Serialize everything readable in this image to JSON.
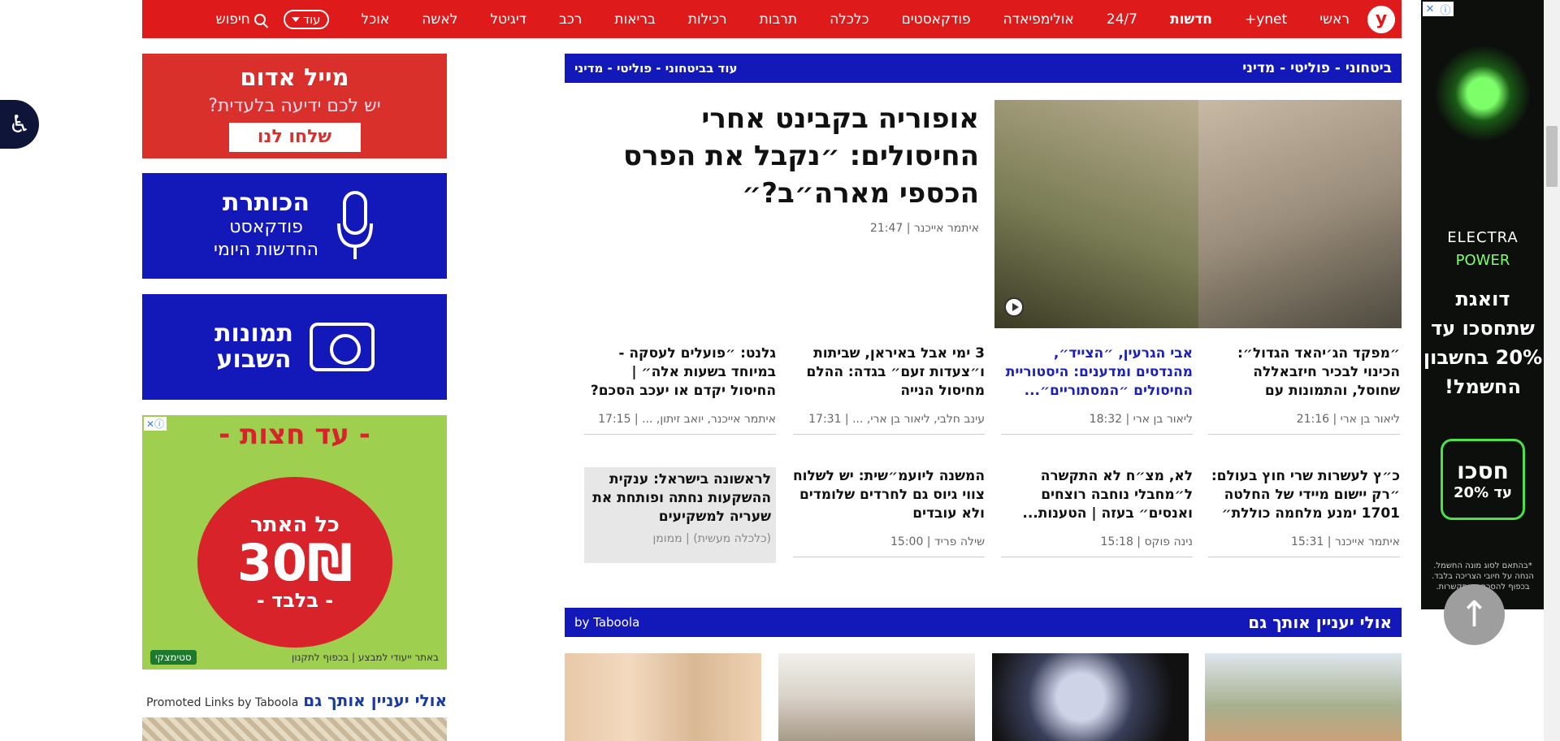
{
  "nav": {
    "logo": "y",
    "items": [
      "ראשי",
      "ynet+",
      "חדשות",
      "24/7",
      "אולימפיאדה",
      "פודקאסטים",
      "כלכלה",
      "תרבות",
      "רכילות",
      "בריאות",
      "רכב",
      "דיגיטל",
      "לאשה",
      "אוכל"
    ],
    "more_label": "עוד",
    "search_label": "חיפוש"
  },
  "sidebar": {
    "red_mail": {
      "title": "מייל אדום",
      "subtitle": "יש לכם ידיעה בלעדית?",
      "button": "שלחו לנו"
    },
    "podcast": {
      "title": "הכותרת",
      "line1": "פודקאסט",
      "line2": "החדשות היומי"
    },
    "photos": {
      "title": "תמונות",
      "line2": "השבוע"
    },
    "ad": {
      "header": "- עד חצות -",
      "line1": "כל האתר",
      "price": "30₪",
      "line3": "- בלבד -",
      "footer": "באתר ייעודי למבצע | בכפוף לתקנון",
      "brand": "סטימצקי"
    },
    "promoted_title": "אולי יעניין אותך גם",
    "promoted_links": "Promoted Links by Taboola"
  },
  "section": {
    "title": "ביטחוני - פוליטי - מדיני",
    "more": "עוד בביטחוני - פוליטי - מדיני"
  },
  "hero": {
    "title": "אופוריה בקבינט אחרי החיסולים: ״נקבל את הפרס הכספי מארה״ב?״",
    "author": "איתמר אייכנר",
    "time": "21:47"
  },
  "articles": [
    {
      "title": "״מפקד הג׳יהאד הגדול״: הכינוי לבכיר חיזבאללה שחוסל, והתמונות עם נסראללה...",
      "meta": "ליאור בן ארי | 21:16"
    },
    {
      "title": "אבי הגרעין, ״הצייד״, מהנדסים ומדענים: היסטוריית החיסולים ״המסתוריים״...",
      "meta": "ליאור בן ארי | 18:32"
    },
    {
      "title": "3 ימי אבל באיראן, שביתות ו״צעדות זעם״ בגדה: ההלם מחיסול הנייה",
      "meta": "עינב חלבי, ליאור בן ארי, ... | 17:31"
    },
    {
      "title": "גלנט: ״פועלים לעסקה - במיוחד בשעות אלה״ | החיסול יקדם או יעכב הסכם?",
      "meta": "איתמר אייכנר, יואב זיתון, ... | 17:15"
    },
    {
      "title": "כ״ץ לעשרות שרי חוץ בעולם: ״רק יישום מיידי של החלטה 1701 ימנע מלחמה כוללת״",
      "meta": "איתמר אייכנר | 15:31"
    },
    {
      "title": "לא, מצ״ח לא התקשרה ל״מחבלי נוחבה רוצחים ואנסים״ בעזה | הטענות...",
      "meta": "נינה פוקס | 15:18"
    },
    {
      "title": "המשנה ליועמ״שית: יש לשלוח צווי גיוס גם לחרדים שלומדים ולא עובדים",
      "meta": "שילה פריד | 15:00"
    },
    {
      "title": "לראשונה בישראל: ענקית ההשקעות נחתה ופותחת את שעריה למשקיעים",
      "meta": "(כלכלה מעשית) | ממומן"
    }
  ],
  "taboola": {
    "title": "אולי יעניין אותך גם",
    "by": "by Taboola"
  },
  "right_ad": {
    "brand": "ELECTRA",
    "brand2": "POWER",
    "headline": "דואגת שתחסכו עד 20% בחשבון החשמל!",
    "button_line1": "חסכו",
    "button_line2": "עד 20%",
    "fine_print": "*בהתאם לסוג מונה החשמל. הנחה על חיובי הצריכה בלבד. בכפוף להסכם ההתקשרות."
  },
  "colors": {
    "brand_red": "#de1a1a",
    "section_blue": "#1318b8",
    "link_blue": "#1a20b8"
  }
}
